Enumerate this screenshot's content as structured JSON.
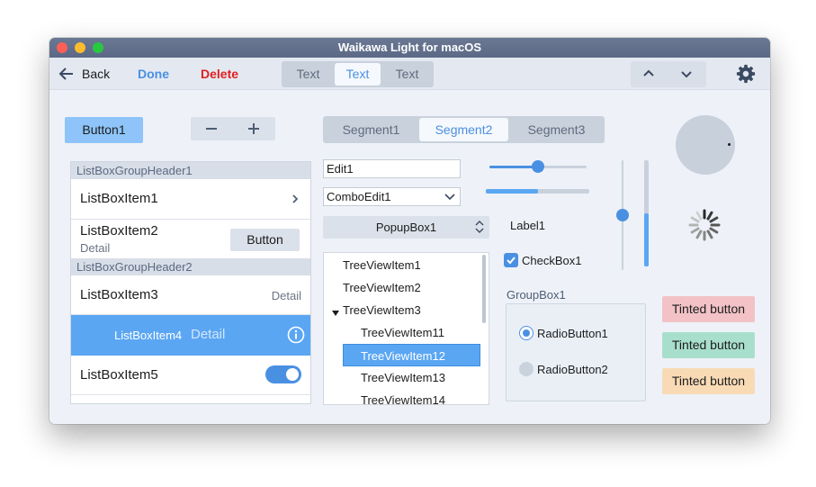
{
  "window": {
    "title": "Waikawa Light for macOS"
  },
  "toolbar": {
    "back_label": "Back",
    "done_label": "Done",
    "delete_label": "Delete",
    "segments": [
      "Text",
      "Text",
      "Text"
    ],
    "selected_segment": 1
  },
  "controls": {
    "button1": "Button1",
    "segments": [
      "Segment1",
      "Segment2",
      "Segment3"
    ],
    "selected_segment": 1,
    "edit_value": "Edit1",
    "combo_value": "ComboEdit1",
    "popup_value": "PopupBox1",
    "label1": "Label1",
    "checkbox_label": "CheckBox1",
    "checkbox_checked": true,
    "groupbox_title": "GroupBox1",
    "radio1": "RadioButton1",
    "radio2": "RadioButton2",
    "radio_selected": 1,
    "tinted_buttons": [
      "Tinted button",
      "Tinted button",
      "Tinted button"
    ],
    "slider_h_value": 0.5,
    "progress_h_value": 0.5,
    "slider_v_value": 0.5,
    "progress_v_value": 0.5
  },
  "listbox": {
    "group1": "ListBoxGroupHeader1",
    "item1": "ListBoxItem1",
    "item2": "ListBoxItem2",
    "item2_detail": "Detail",
    "item2_button": "Button",
    "group2": "ListBoxGroupHeader2",
    "item3": "ListBoxItem3",
    "item3_detail": "Detail",
    "item4": "ListBoxItem4",
    "item4_detail": "Detail",
    "item5": "ListBoxItem5",
    "item5_toggle_on": true
  },
  "tree": {
    "items": [
      "TreeViewItem1",
      "TreeViewItem2",
      "TreeViewItem3",
      "TreeViewItem11",
      "TreeViewItem12",
      "TreeViewItem13",
      "TreeViewItem14"
    ],
    "selected": "TreeViewItem12"
  },
  "colors": {
    "accent": "#4a90e2",
    "selection": "#5aa6f3",
    "delete": "#e02020"
  }
}
